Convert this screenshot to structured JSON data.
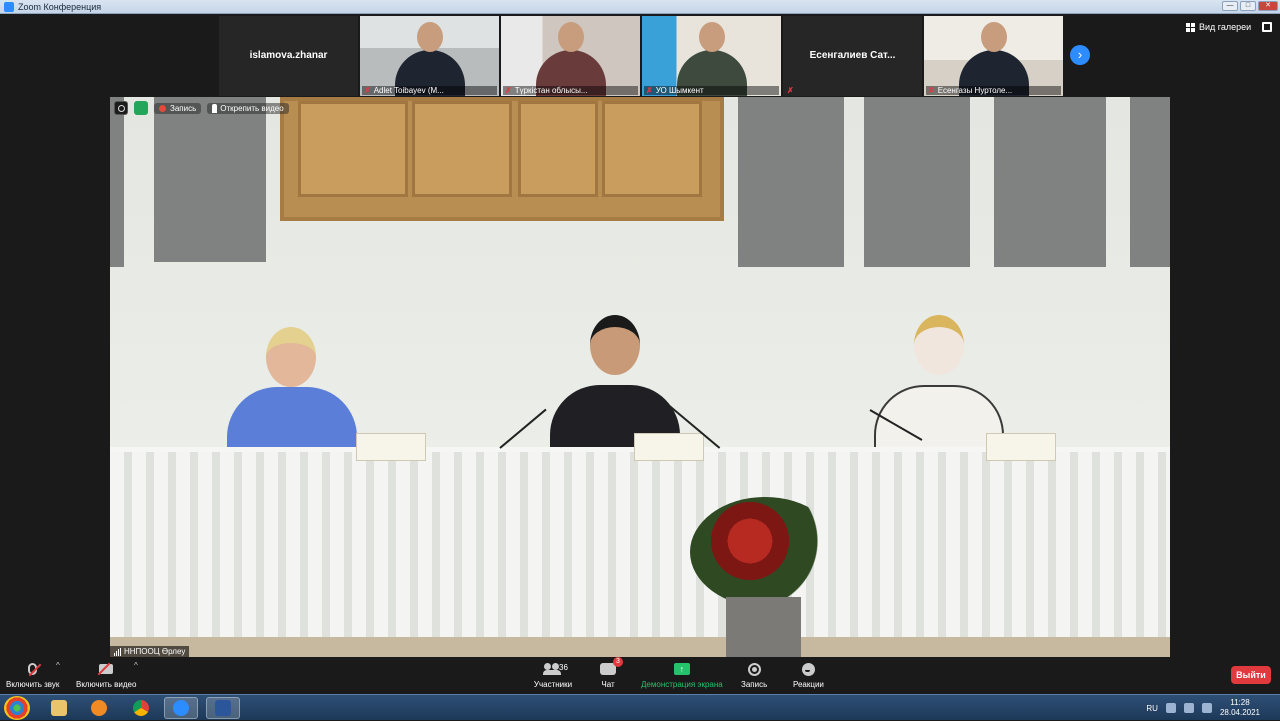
{
  "window": {
    "title": "Zoom Конференция",
    "controls": [
      "—",
      "□",
      "✕"
    ]
  },
  "header": {
    "gallery_label": "Вид галереи",
    "next_page_glyph": "›"
  },
  "participants_strip": [
    {
      "name": "islamova.zhanar",
      "video": false
    },
    {
      "name": "Adlet Toibayev (M...",
      "video": true
    },
    {
      "name": "Түркістан облысы...",
      "video": true
    },
    {
      "name": "УО Шымкент",
      "video": true
    },
    {
      "name": "Есенгалиев Сат...",
      "video": false
    },
    {
      "name": "Есенгазы Нуртоле...",
      "video": true
    }
  ],
  "main_video": {
    "recording_label": "Запись",
    "unpin_label": "Открепить видео",
    "speaker_name": "ННПООЦ Өрлеу"
  },
  "toolbar": {
    "unmute_label": "Включить звук",
    "start_video_label": "Включить видео",
    "participants_label": "Участники",
    "participants_count": "36",
    "chat_label": "Чат",
    "chat_badge": "3",
    "share_label": "Демонстрация экрана",
    "record_label": "Запись",
    "reactions_label": "Реакции",
    "leave_label": "Выйти"
  },
  "taskbar": {
    "apps": [
      "explorer",
      "media-player",
      "chrome",
      "zoom",
      "word"
    ],
    "active_app": "word",
    "language": "RU",
    "time": "11:28",
    "date": "28.04.2021"
  },
  "colors": {
    "accent": "#2d8cff",
    "leave": "#e0393e",
    "share": "#23c26b",
    "muted": "#e0393e"
  }
}
